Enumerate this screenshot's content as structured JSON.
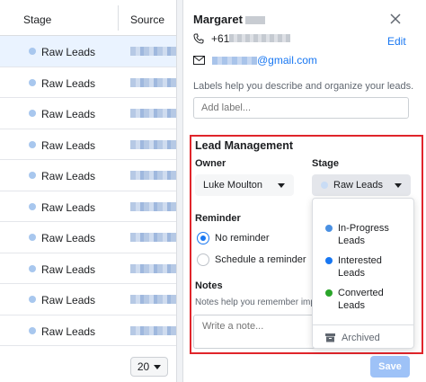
{
  "table": {
    "headers": {
      "stage": "Stage",
      "source": "Source"
    },
    "rows": [
      {
        "stage": "Raw Leads",
        "selected": true
      },
      {
        "stage": "Raw Leads"
      },
      {
        "stage": "Raw Leads"
      },
      {
        "stage": "Raw Leads"
      },
      {
        "stage": "Raw Leads"
      },
      {
        "stage": "Raw Leads"
      },
      {
        "stage": "Raw Leads"
      },
      {
        "stage": "Raw Leads"
      },
      {
        "stage": "Raw Leads"
      },
      {
        "stage": "Raw Leads"
      }
    ],
    "page_size": "20"
  },
  "panel": {
    "name": "Margaret",
    "phone_prefix": "+61",
    "edit_label": "Edit",
    "email_domain": "@gmail.com",
    "labels_help": "Labels help you describe and organize your leads.",
    "label_placeholder": "Add label...",
    "lead_management": {
      "title": "Lead Management",
      "owner_label": "Owner",
      "owner_value": "Luke Moulton",
      "stage_label": "Stage",
      "stage_value": "Raw Leads",
      "reminder_label": "Reminder",
      "reminder_options": [
        "No reminder",
        "Schedule a reminder"
      ],
      "reminder_selected": 0,
      "notes_label": "Notes",
      "notes_help": "Notes help you remember importa",
      "notes_placeholder": "Write a note..."
    },
    "stage_menu": {
      "items": [
        {
          "label": "In-Progress Leads",
          "line1": "In-Progress",
          "line2": "Leads",
          "color": "#4a90e2"
        },
        {
          "label": "Interested Leads",
          "line1": "Interested",
          "line2": "Leads",
          "color": "#1877f2"
        },
        {
          "label": "Converted Leads",
          "line1": "Converted",
          "line2": "Leads",
          "color": "#2aa52a"
        }
      ],
      "archived_label": "Archived"
    },
    "save_label": "Save"
  },
  "colors": {
    "accent": "#1877f2",
    "highlight_border": "#e0252b",
    "raw_leads_dot": "#a8c7ee"
  }
}
